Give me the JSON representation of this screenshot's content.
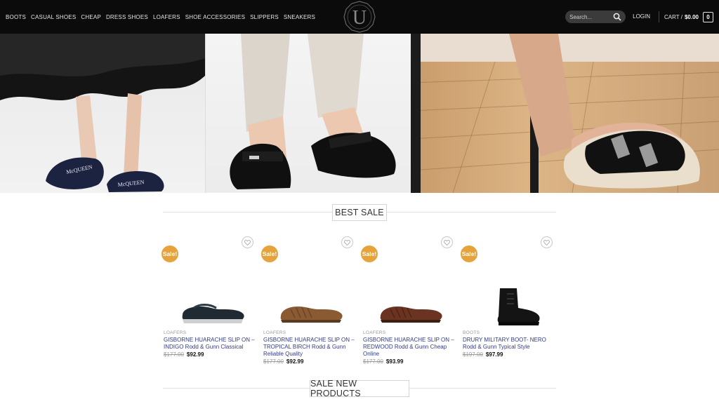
{
  "nav": {
    "items": [
      "BOOTS",
      "CASUAL SHOES",
      "CHEAP",
      "DRESS SHOES",
      "LOAFERS",
      "SHOE ACCESSORIES",
      "SLIPPERS",
      "SNEAKERS"
    ]
  },
  "logo": {
    "letter": "U"
  },
  "search": {
    "placeholder": "Search..."
  },
  "account": {
    "login_label": "LOGIN"
  },
  "cart": {
    "label": "CART /",
    "total": "$0.00",
    "count": "0"
  },
  "sections": {
    "best_sale": "BEST SALE",
    "new_products": "SALE NEW PRODUCTS"
  },
  "products": [
    {
      "badge": "Sale!",
      "category": "LOAFERS",
      "name": "GISBORNE HUARACHE SLIP ON – INDIGO Rodd & Gunn Classical",
      "old_price": "$177.00",
      "price": "$92.99",
      "color": "#1f2a33"
    },
    {
      "badge": "Sale!",
      "category": "LOAFERS",
      "name": "GISBORNE HUARACHE SLIP ON – TROPICAL BIRCH Rodd & Gunn Reliable Quality",
      "old_price": "$177.00",
      "price": "$92.99",
      "color": "#8a5a32"
    },
    {
      "badge": "Sale!",
      "category": "LOAFERS",
      "name": "GISBORNE HUARACHE SLIP ON – REDWOOD Rodd & Gunn Cheap Online",
      "old_price": "$177.00",
      "price": "$93.99",
      "color": "#6b3422"
    },
    {
      "badge": "Sale!",
      "category": "BOOTS",
      "name": "DRURY MILITARY BOOT- NERO Rodd & Gunn Typical Style",
      "old_price": "$197.00",
      "price": "$97.99",
      "color": "#141414"
    }
  ],
  "colors": {
    "header_bg": "#0b0b0b",
    "sale_badge": "#e7a33b",
    "product_name": "#2f3a8a"
  },
  "icons": [
    "search-icon",
    "heart-icon",
    "logo-emblem"
  ]
}
